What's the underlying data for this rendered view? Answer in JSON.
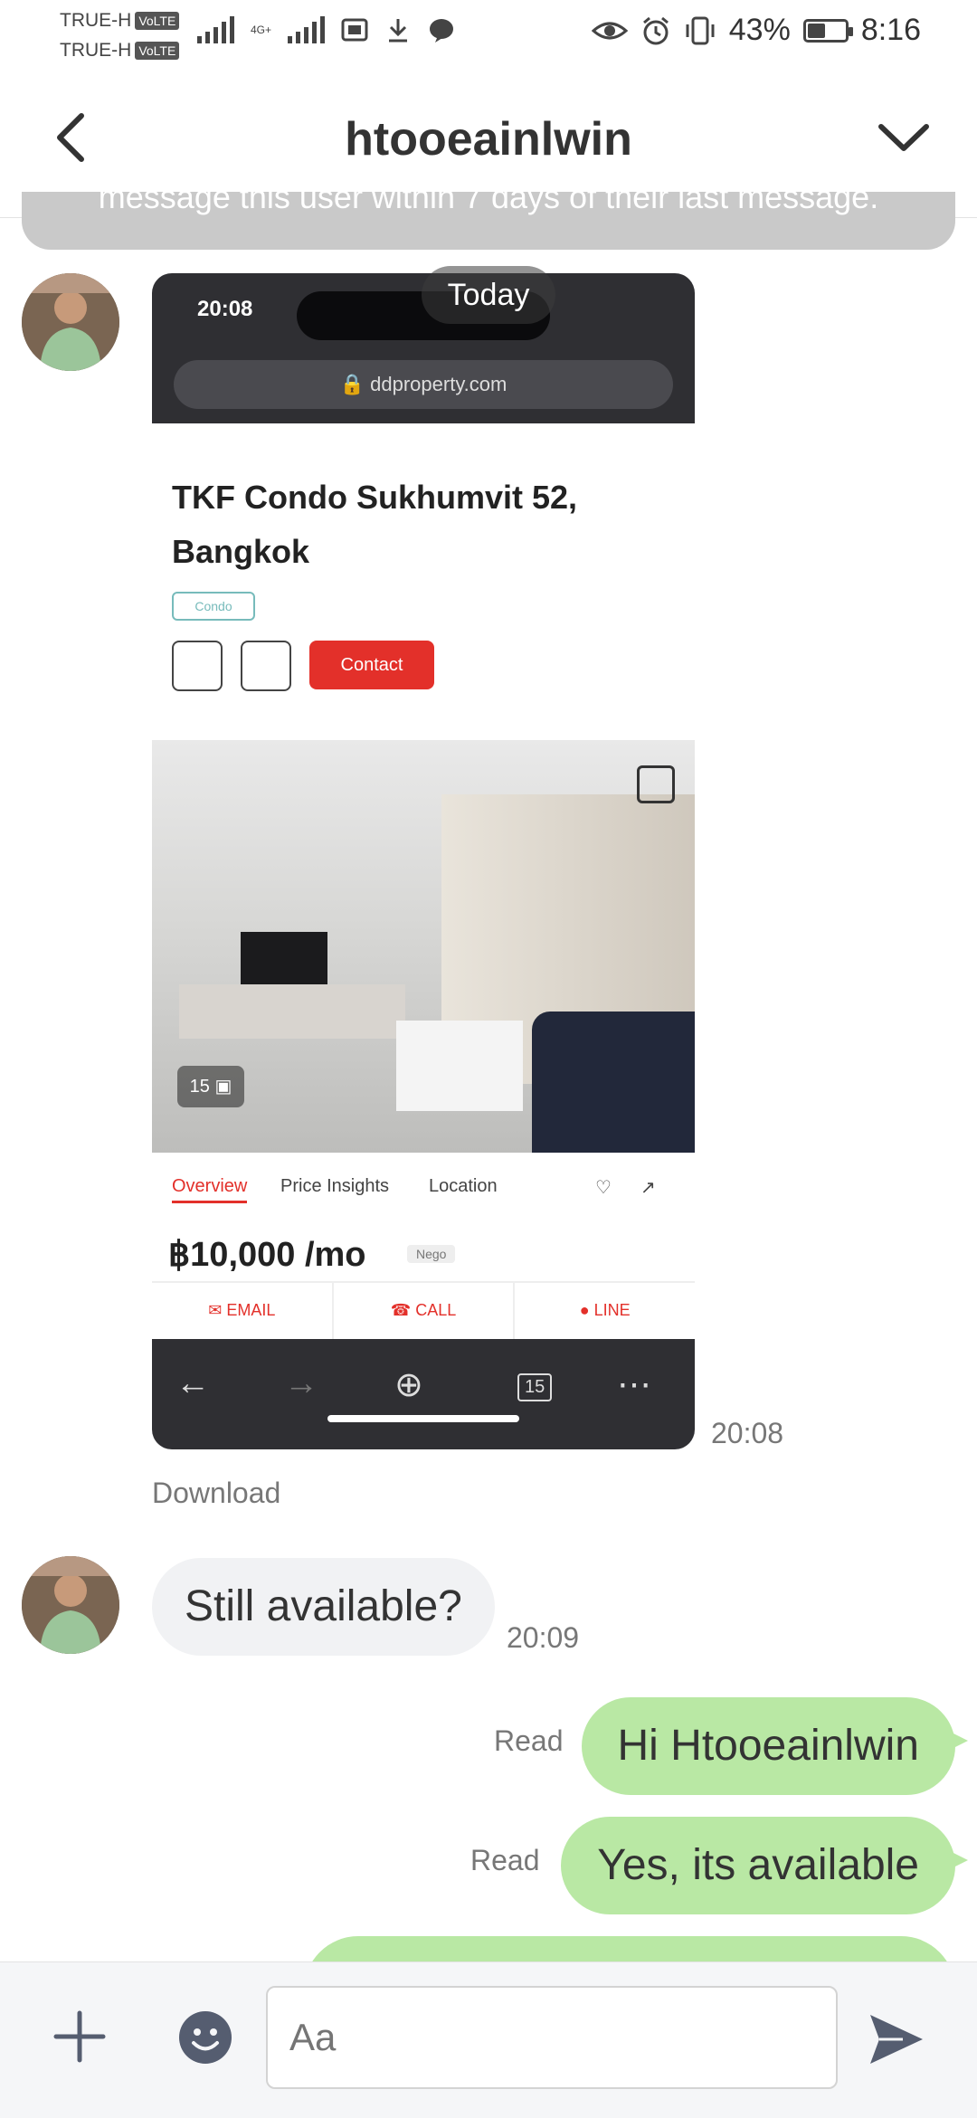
{
  "status_bar": {
    "carrier_1": "TRUE-H",
    "carrier_2": "TRUE-H",
    "volte": "VoLTE",
    "network": "4G+",
    "battery_percent": "43%",
    "battery_level": 0.43,
    "time": "8:16"
  },
  "header": {
    "title": "htooeainlwin"
  },
  "notice": {
    "text": "message this user within 7 days of their last message."
  },
  "date_separator": "Today",
  "screenshot": {
    "time": "20:08",
    "url": "ddproperty.com",
    "listing_title": "TKF Condo Sukhumvit 52, Bangkok",
    "tag": "Condo",
    "contact_label": "Contact",
    "photo_count": "15",
    "tabs": [
      "Overview",
      "Price Insights",
      "Location"
    ],
    "price": "฿10,000 /mo",
    "negotiable": "Nego",
    "actions": [
      "✉ EMAIL",
      "☎ CALL",
      "● LINE"
    ],
    "tab_count": "15"
  },
  "messages": {
    "image_time": "20:08",
    "download_label": "Download",
    "incoming_1": {
      "text": "Still available?",
      "time": "20:09"
    },
    "outgoing_1": {
      "text": "Hi Htooeainlwin",
      "status": "Read"
    },
    "outgoing_2": {
      "text": "Yes, its available",
      "status": "Read"
    }
  },
  "composer": {
    "placeholder": "Aa"
  }
}
